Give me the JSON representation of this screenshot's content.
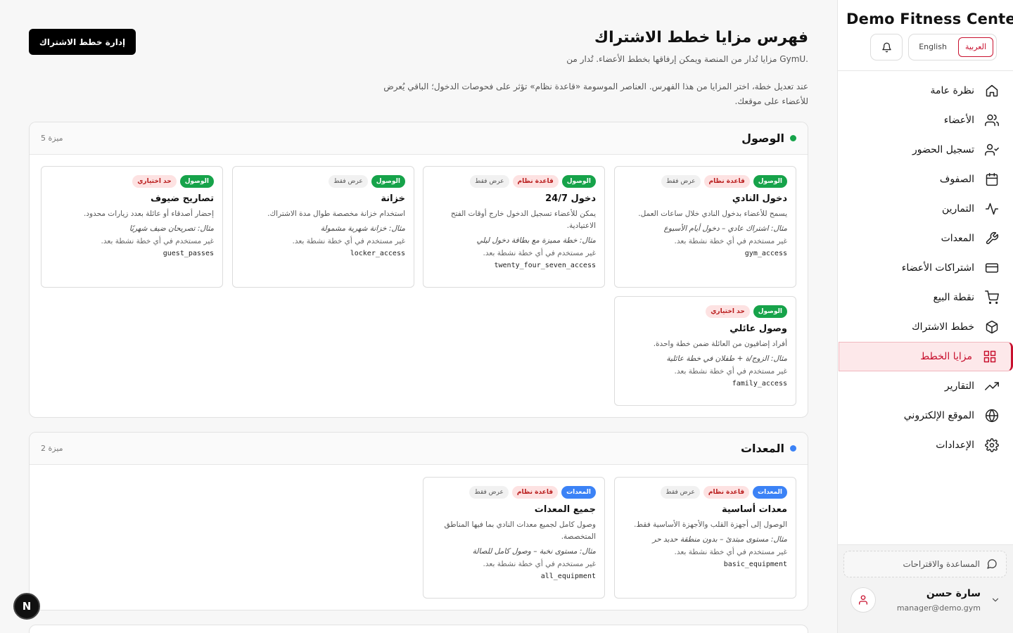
{
  "brand": "Demo Fitness Center",
  "lang": {
    "arabic": "العربية",
    "english": "English"
  },
  "nav": [
    {
      "label": "نظرة عامة",
      "icon": "home-icon"
    },
    {
      "label": "الأعضاء",
      "icon": "users-icon"
    },
    {
      "label": "تسجيل الحضور",
      "icon": "user-check-icon"
    },
    {
      "label": "الصفوف",
      "icon": "calendar-icon"
    },
    {
      "label": "التمارين",
      "icon": "activity-icon"
    },
    {
      "label": "المعدات",
      "icon": "wrench-icon"
    },
    {
      "label": "اشتراكات الأعضاء",
      "icon": "credit-card-icon"
    },
    {
      "label": "نقطة البيع",
      "icon": "cart-icon"
    },
    {
      "label": "خطط الاشتراك",
      "icon": "package-icon"
    },
    {
      "label": "مزايا الخطط",
      "icon": "grid-icon"
    },
    {
      "label": "التقارير",
      "icon": "trending-up-icon"
    },
    {
      "label": "الموقع الإلكتروني",
      "icon": "globe-icon"
    },
    {
      "label": "الإعدادات",
      "icon": "settings-icon"
    }
  ],
  "help": "المساعدة والاقتراحات",
  "user": {
    "name": "سارة حسن",
    "email": "manager@demo.gym"
  },
  "header": {
    "title": "فهرس مزايا خطط الاشتراك",
    "subtitle": "مزايا تُدار من المنصة ويمكن إرفاقها بخطط الأعضاء. تُدار من GymU.",
    "description": "عند تعديل خطة، اختر المزايا من هذا الفهرس. العناصر الموسومة «قاعدة نظام» تؤثر على فحوصات الدخول؛ الباقي يُعرض للأعضاء على موقعك.",
    "manage_button": "إدارة خطط الاشتراك"
  },
  "badges": {
    "rule": "قاعدة نظام",
    "display": "عرض فقط",
    "limit": "حد اختياري"
  },
  "sections": [
    {
      "title": "الوصول",
      "count": "5 ميزة",
      "color": "#16a34a",
      "cards": [
        {
          "category": "الوصول",
          "flags": [
            "rule",
            "display"
          ],
          "title": "دخول النادي",
          "desc": "يسمح للأعضاء بدخول النادي خلال ساعات العمل.",
          "example": "مثال: اشتراك عادي – دخول أيام الأسبوع",
          "usage": "غير مستخدم في أي خطة نشطة بعد.",
          "key": "gym_access"
        },
        {
          "category": "الوصول",
          "flags": [
            "rule",
            "display"
          ],
          "title": "دخول 24/7",
          "desc": "يمكن للأعضاء تسجيل الدخول خارج أوقات الفتح الاعتيادية.",
          "example": "مثال: خطة مميزة مع بطاقة دخول ليلي",
          "usage": "غير مستخدم في أي خطة نشطة بعد.",
          "key": "twenty_four_seven_access"
        },
        {
          "category": "الوصول",
          "flags": [
            "display"
          ],
          "title": "خزانة",
          "desc": "استخدام خزانة مخصصة طوال مدة الاشتراك.",
          "example": "مثال: خزانة شهرية مشمولة",
          "usage": "غير مستخدم في أي خطة نشطة بعد.",
          "key": "locker_access"
        },
        {
          "category": "الوصول",
          "flags": [
            "limit"
          ],
          "title": "تصاريح ضيوف",
          "desc": "إحضار أصدقاء أو عائلة بعدد زيارات محدود.",
          "example": "مثال: تصريحان ضيف شهريًا",
          "usage": "غير مستخدم في أي خطة نشطة بعد.",
          "key": "guest_passes"
        },
        {
          "category": "الوصول",
          "flags": [
            "limit"
          ],
          "title": "وصول عائلي",
          "desc": "أفراد إضافيون من العائلة ضمن خطة واحدة.",
          "example": "مثال: الزوج/ة + طفلان في خطة عائلية",
          "usage": "غير مستخدم في أي خطة نشطة بعد.",
          "key": "family_access"
        }
      ]
    },
    {
      "title": "المعدات",
      "count": "2 ميزة",
      "color": "#3b82f6",
      "cards": [
        {
          "category": "المعدات",
          "flags": [
            "rule",
            "display"
          ],
          "title": "معدات أساسية",
          "desc": "الوصول إلى أجهزة القلب والأجهزة الأساسية فقط.",
          "example": "مثال: مستوى مبتدئ – بدون منطقة حديد حر",
          "usage": "غير مستخدم في أي خطة نشطة بعد.",
          "key": "basic_equipment"
        },
        {
          "category": "المعدات",
          "flags": [
            "rule",
            "display"
          ],
          "title": "جميع المعدات",
          "desc": "وصول كامل لجميع معدات النادي بما فيها المناطق المتخصصة.",
          "example": "مثال: مستوى نخبة – وصول كامل للصالة",
          "usage": "غير مستخدم في أي خطة نشطة بعد.",
          "key": "all_equipment"
        }
      ]
    }
  ],
  "nextjs_badge": "N"
}
